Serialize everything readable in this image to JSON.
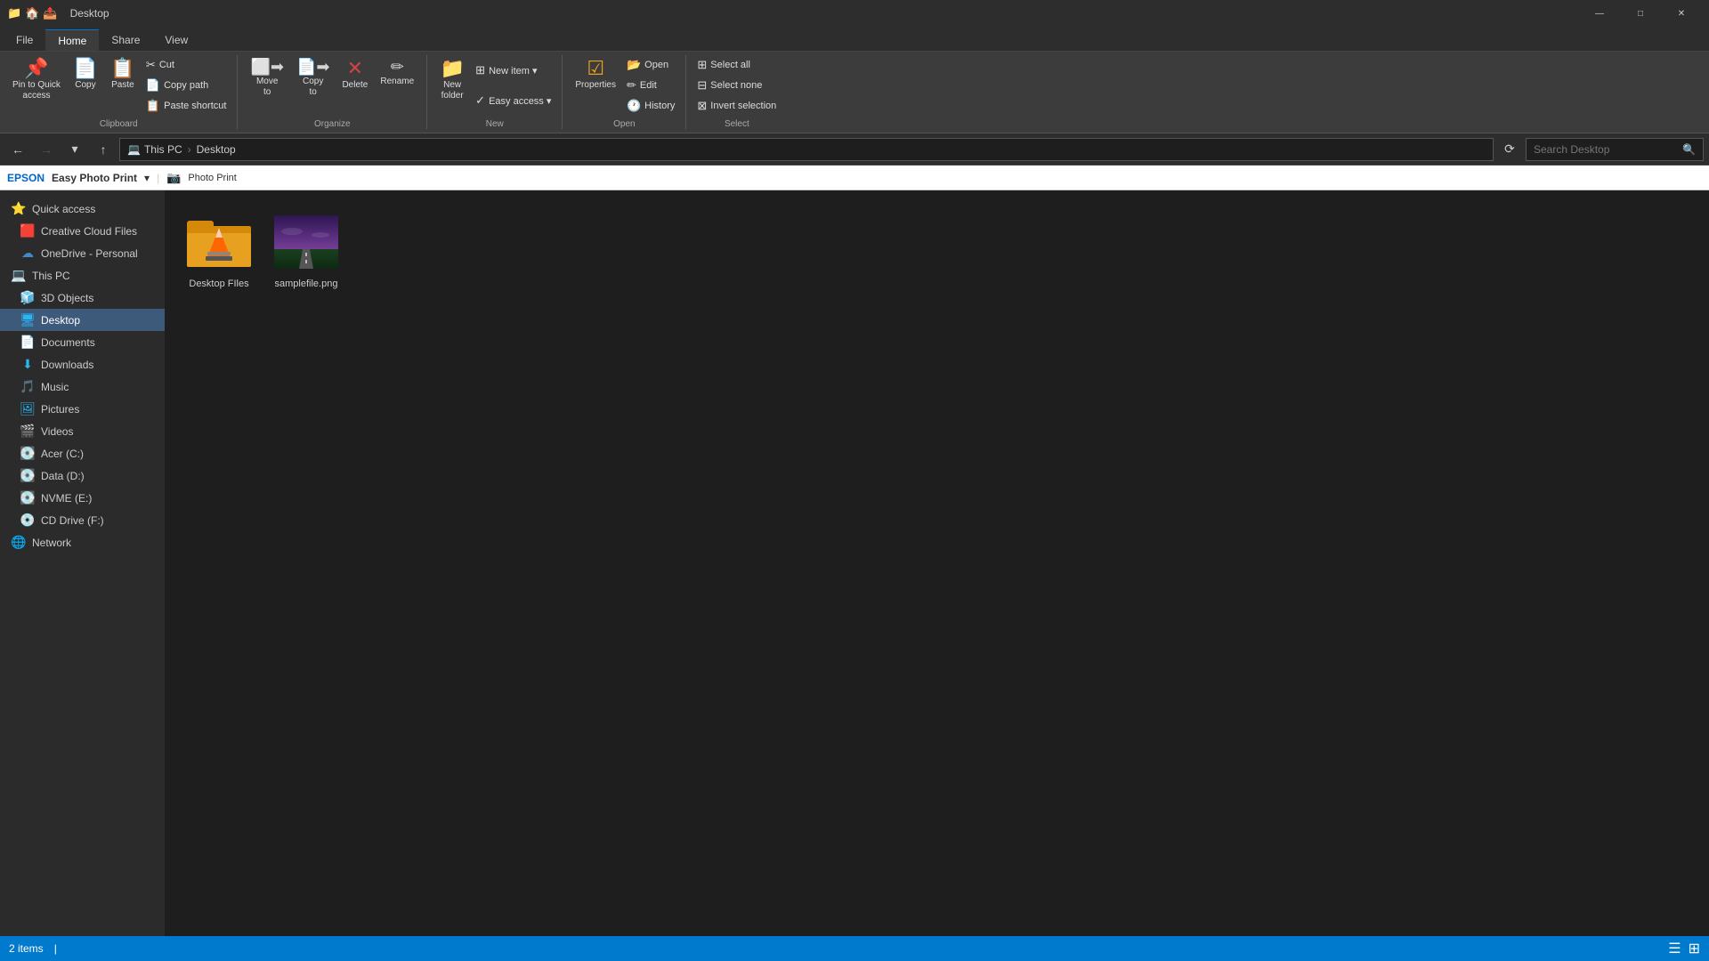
{
  "window": {
    "title": "Desktop",
    "titlebar_icons": [
      "📁",
      "🏠",
      "📤"
    ]
  },
  "ribbon": {
    "tabs": [
      "File",
      "Home",
      "Share",
      "View"
    ],
    "active_tab": "Home",
    "groups": {
      "clipboard": {
        "label": "Clipboard",
        "buttons": [
          {
            "id": "pin-quick-access",
            "icon": "📌",
            "label": "Pin to Quick\naccess"
          },
          {
            "id": "copy",
            "icon": "📄",
            "label": "Copy"
          },
          {
            "id": "paste",
            "icon": "📋",
            "label": "Paste"
          }
        ],
        "small_buttons": [
          {
            "id": "cut",
            "icon": "✂",
            "label": "Cut"
          },
          {
            "id": "copy-path",
            "icon": "📄",
            "label": "Copy path"
          },
          {
            "id": "paste-shortcut",
            "icon": "📋",
            "label": "Paste shortcut"
          }
        ]
      },
      "organize": {
        "label": "Organize",
        "buttons": [
          {
            "id": "move-to",
            "icon": "⬜",
            "label": "Move\nto"
          },
          {
            "id": "copy-to",
            "icon": "⬜",
            "label": "Copy\nto"
          },
          {
            "id": "delete",
            "icon": "✕",
            "label": "Delete"
          },
          {
            "id": "rename",
            "icon": "✏",
            "label": "Rename"
          }
        ]
      },
      "new": {
        "label": "New",
        "buttons": [
          {
            "id": "new-folder",
            "icon": "📁",
            "label": "New\nfolder"
          }
        ],
        "small_buttons": [
          {
            "id": "new-item",
            "icon": "⊞",
            "label": "New item ▾"
          },
          {
            "id": "easy-access",
            "icon": "✓",
            "label": "Easy access ▾"
          }
        ]
      },
      "open": {
        "label": "Open",
        "buttons": [
          {
            "id": "properties",
            "icon": "ℹ",
            "label": "Properties"
          }
        ],
        "small_buttons": [
          {
            "id": "open",
            "icon": "📂",
            "label": "Open"
          },
          {
            "id": "edit",
            "icon": "✏",
            "label": "Edit"
          },
          {
            "id": "history",
            "icon": "🕐",
            "label": "History"
          }
        ]
      },
      "select": {
        "label": "Select",
        "small_buttons": [
          {
            "id": "select-all",
            "icon": "⊞",
            "label": "Select all"
          },
          {
            "id": "select-none",
            "icon": "⊟",
            "label": "Select none"
          },
          {
            "id": "invert-selection",
            "icon": "⊠",
            "label": "Invert selection"
          }
        ]
      }
    }
  },
  "addressbar": {
    "back_enabled": true,
    "forward_enabled": false,
    "up_enabled": true,
    "path_parts": [
      "💻 This PC",
      "Desktop"
    ],
    "search_placeholder": "Search Desktop"
  },
  "epson": {
    "brand": "EPSON",
    "product": "Easy Photo Print",
    "submenu": "Photo Print"
  },
  "sidebar": {
    "items": [
      {
        "id": "quick-access",
        "icon": "⭐",
        "label": "Quick access",
        "indent": 0
      },
      {
        "id": "creative-cloud",
        "icon": "🟥",
        "label": "Creative Cloud Files",
        "indent": 1
      },
      {
        "id": "onedrive",
        "icon": "☁",
        "label": "OneDrive - Personal",
        "indent": 1
      },
      {
        "id": "this-pc",
        "icon": "💻",
        "label": "This PC",
        "indent": 0
      },
      {
        "id": "3d-objects",
        "icon": "🧊",
        "label": "3D Objects",
        "indent": 1
      },
      {
        "id": "desktop",
        "icon": "🖥",
        "label": "Desktop",
        "indent": 1,
        "active": true
      },
      {
        "id": "documents",
        "icon": "📄",
        "label": "Documents",
        "indent": 1
      },
      {
        "id": "downloads",
        "icon": "⬇",
        "label": "Downloads",
        "indent": 1
      },
      {
        "id": "music",
        "icon": "🎵",
        "label": "Music",
        "indent": 1
      },
      {
        "id": "pictures",
        "icon": "🖼",
        "label": "Pictures",
        "indent": 1
      },
      {
        "id": "videos",
        "icon": "🎬",
        "label": "Videos",
        "indent": 1
      },
      {
        "id": "acer-c",
        "icon": "💽",
        "label": "Acer (C:)",
        "indent": 1
      },
      {
        "id": "data-d",
        "icon": "💽",
        "label": "Data (D:)",
        "indent": 1
      },
      {
        "id": "nvme-e",
        "icon": "💽",
        "label": "NVME (E:)",
        "indent": 1
      },
      {
        "id": "cd-drive",
        "icon": "💿",
        "label": "CD Drive (F:)",
        "indent": 1
      },
      {
        "id": "network",
        "icon": "🌐",
        "label": "Network",
        "indent": 0
      }
    ]
  },
  "content": {
    "files": [
      {
        "id": "desktop-files",
        "name": "Desktop FIles",
        "type": "folder-vlc"
      },
      {
        "id": "samplefile-png",
        "name": "samplefile.png",
        "type": "image"
      }
    ]
  },
  "statusbar": {
    "item_count": "2 items",
    "separator": "|"
  }
}
